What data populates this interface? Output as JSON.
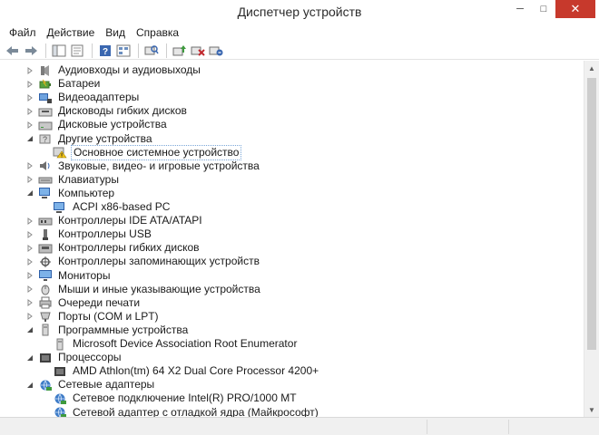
{
  "window": {
    "title": "Диспетчер устройств",
    "controls": {
      "minimize": "─",
      "maximize": "□",
      "close": "✕"
    }
  },
  "menu": [
    "Файл",
    "Действие",
    "Вид",
    "Справка"
  ],
  "toolbar": {
    "buttons": [
      "back-icon",
      "forward-icon",
      "console-tree-icon",
      "properties-icon",
      "help-icon",
      "view-icon",
      "scan-hardware-icon",
      "update-driver-icon",
      "disable-device-icon",
      "uninstall-device-icon"
    ]
  },
  "tree": [
    {
      "label": "Аудиовходы и аудиовыходы",
      "level": 1,
      "expander": "collapsed",
      "icon": "audio-io-icon"
    },
    {
      "label": "Батареи",
      "level": 1,
      "expander": "collapsed",
      "icon": "battery-icon"
    },
    {
      "label": "Видеоадаптеры",
      "level": 1,
      "expander": "collapsed",
      "icon": "display-adapter-icon"
    },
    {
      "label": "Дисководы гибких дисков",
      "level": 1,
      "expander": "collapsed",
      "icon": "floppy-drive-icon"
    },
    {
      "label": "Дисковые устройства",
      "level": 1,
      "expander": "collapsed",
      "icon": "disk-drive-icon"
    },
    {
      "label": "Другие устройства",
      "level": 1,
      "expander": "expanded",
      "icon": "other-devices-icon"
    },
    {
      "label": "Основное системное устройство",
      "level": 2,
      "expander": "none",
      "icon": "warning-device-icon",
      "selected": true
    },
    {
      "label": "Звуковые, видео- и игровые устройства",
      "level": 1,
      "expander": "collapsed",
      "icon": "sound-icon"
    },
    {
      "label": "Клавиатуры",
      "level": 1,
      "expander": "collapsed",
      "icon": "keyboard-icon"
    },
    {
      "label": "Компьютер",
      "level": 1,
      "expander": "expanded",
      "icon": "computer-icon"
    },
    {
      "label": "ACPI x86-based PC",
      "level": 2,
      "expander": "none",
      "icon": "computer-icon"
    },
    {
      "label": "Контроллеры IDE ATA/ATAPI",
      "level": 1,
      "expander": "collapsed",
      "icon": "ide-controller-icon"
    },
    {
      "label": "Контроллеры USB",
      "level": 1,
      "expander": "collapsed",
      "icon": "usb-icon"
    },
    {
      "label": "Контроллеры гибких дисков",
      "level": 1,
      "expander": "collapsed",
      "icon": "floppy-controller-icon"
    },
    {
      "label": "Контроллеры запоминающих устройств",
      "level": 1,
      "expander": "collapsed",
      "icon": "storage-controller-icon"
    },
    {
      "label": "Мониторы",
      "level": 1,
      "expander": "collapsed",
      "icon": "monitor-icon"
    },
    {
      "label": "Мыши и иные указывающие устройства",
      "level": 1,
      "expander": "collapsed",
      "icon": "mouse-icon"
    },
    {
      "label": "Очереди печати",
      "level": 1,
      "expander": "collapsed",
      "icon": "printer-icon"
    },
    {
      "label": "Порты (COM и LPT)",
      "level": 1,
      "expander": "collapsed",
      "icon": "port-icon"
    },
    {
      "label": "Программные устройства",
      "level": 1,
      "expander": "expanded",
      "icon": "software-device-icon"
    },
    {
      "label": "Microsoft Device Association Root Enumerator",
      "level": 2,
      "expander": "none",
      "icon": "software-device-icon"
    },
    {
      "label": "Процессоры",
      "level": 1,
      "expander": "expanded",
      "icon": "processor-icon"
    },
    {
      "label": "AMD Athlon(tm) 64 X2 Dual Core Processor 4200+",
      "level": 2,
      "expander": "none",
      "icon": "processor-icon"
    },
    {
      "label": "Сетевые адаптеры",
      "level": 1,
      "expander": "expanded",
      "icon": "network-adapter-icon"
    },
    {
      "label": "Сетевое подключение Intel(R) PRO/1000 MT",
      "level": 2,
      "expander": "none",
      "icon": "network-adapter-icon"
    },
    {
      "label": "Сетевой адаптер с отладкой ядра (Майкрософт)",
      "level": 2,
      "expander": "none",
      "icon": "network-adapter-icon"
    }
  ]
}
